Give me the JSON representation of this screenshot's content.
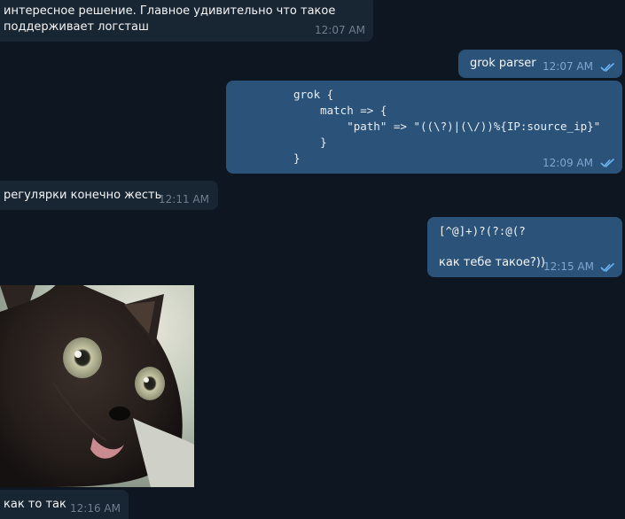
{
  "messages": [
    {
      "id": "m1",
      "dir": "in",
      "lines": [
        "интересное решение. Главное удивительно что такое",
        "поддерживает логсташ"
      ],
      "time": "12:07 AM"
    },
    {
      "id": "m2",
      "dir": "out",
      "text": "grok parser",
      "time": "12:07 AM",
      "read": true
    },
    {
      "id": "m3",
      "dir": "out",
      "code": [
        "grok {",
        "    match => {",
        "        \"path\" => \"((\\?)|(\\/))%{IP:source_ip}\"",
        "    }",
        "}"
      ],
      "time": "12:09 AM",
      "read": true
    },
    {
      "id": "m4",
      "dir": "in",
      "text": "регулярки конечно жесть",
      "time": "12:11 AM"
    },
    {
      "id": "m5",
      "dir": "out",
      "lines": [
        "[^@]+)?(?:@(?",
        "",
        "как тебе такое?))"
      ],
      "time": "12:15 AM",
      "read": true
    },
    {
      "id": "m6",
      "dir": "in",
      "media": "cat-photo"
    },
    {
      "id": "m7",
      "dir": "in",
      "text": "как то так",
      "time": "12:16 AM"
    }
  ],
  "colors": {
    "background": "#0e1621",
    "incoming": "#182533",
    "outgoing": "#2b5278",
    "check": "#6ab3f3"
  }
}
